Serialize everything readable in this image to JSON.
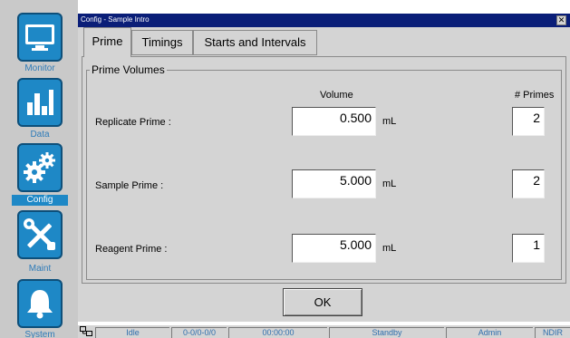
{
  "sidebar": {
    "items": [
      {
        "label": "Monitor",
        "icon": "monitor-icon"
      },
      {
        "label": "Data",
        "icon": "bar-chart-icon"
      },
      {
        "label": "Config",
        "icon": "gears-icon"
      },
      {
        "label": "Maint",
        "icon": "tools-icon"
      },
      {
        "label": "System",
        "icon": "bell-icon"
      }
    ],
    "active": "Config"
  },
  "window": {
    "title": "Config - Sample Intro",
    "close_glyph": "✕"
  },
  "tabs": [
    {
      "label": "Prime"
    },
    {
      "label": "Timings"
    },
    {
      "label": "Starts and Intervals"
    }
  ],
  "prime_volumes": {
    "group_title": "Prime Volumes",
    "volume_header": "Volume",
    "primes_header": "# Primes",
    "rows": [
      {
        "label": "Replicate Prime :",
        "volume": "0.500",
        "unit": "mL",
        "primes": "2"
      },
      {
        "label": "Sample Prime :",
        "volume": "5.000",
        "unit": "mL",
        "primes": "2"
      },
      {
        "label": "Reagent Prime :",
        "volume": "5.000",
        "unit": "mL",
        "primes": "1"
      }
    ]
  },
  "ok_label": "OK",
  "statusbar": {
    "icon": "network-icon",
    "cells": [
      "Idle",
      "0-0/0-0/0",
      "00:00:00",
      "Standby",
      "Admin",
      "NDIR"
    ]
  },
  "colors": {
    "accent": "#1e88c6",
    "titlebar": "#0a1e78",
    "status_text": "#2e6fae"
  }
}
